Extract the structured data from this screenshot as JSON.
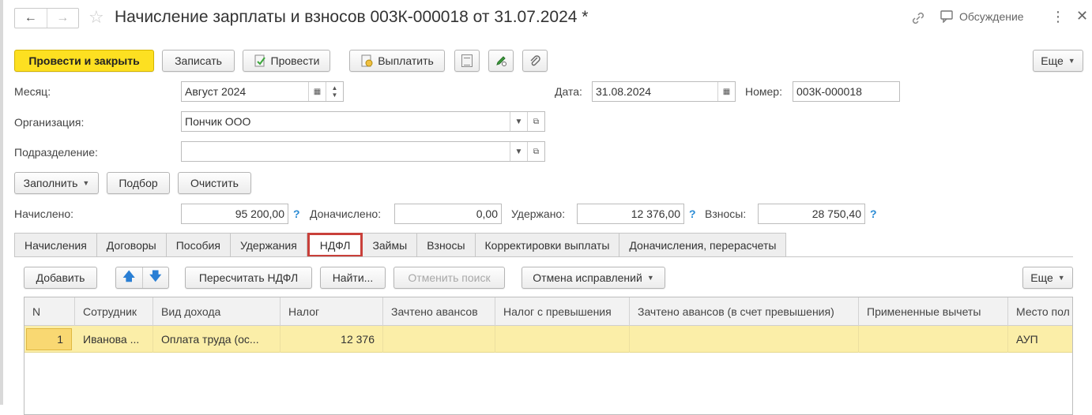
{
  "header": {
    "title": "Начисление зарплаты и взносов 003К-000018 от 31.07.2024 *",
    "discussion_label": "Обсуждение",
    "back_icon": "←",
    "forward_icon": "→"
  },
  "toolbar": {
    "post_and_close": "Провести и закрыть",
    "save": "Записать",
    "post": "Провести",
    "pay": "Выплатить",
    "more": "Еще"
  },
  "form": {
    "month_label": "Месяц:",
    "month_value": "Август 2024",
    "date_label": "Дата:",
    "date_value": "31.08.2024",
    "number_label": "Номер:",
    "number_value": "003К-000018",
    "org_label": "Организация:",
    "org_value": "Пончик ООО",
    "dept_label": "Подразделение:",
    "dept_value": ""
  },
  "actions": {
    "fill": "Заполнить",
    "pick": "Подбор",
    "clear": "Очистить"
  },
  "totals": {
    "accrued_label": "Начислено:",
    "accrued_value": "95 200,00",
    "extra_label": "Доначислено:",
    "extra_value": "0,00",
    "withheld_label": "Удержано:",
    "withheld_value": "12 376,00",
    "contrib_label": "Взносы:",
    "contrib_value": "28 750,40",
    "help": "?"
  },
  "tabs": [
    {
      "label": "Начисления"
    },
    {
      "label": "Договоры"
    },
    {
      "label": "Пособия"
    },
    {
      "label": "Удержания"
    },
    {
      "label": "НДФЛ"
    },
    {
      "label": "Займы"
    },
    {
      "label": "Взносы"
    },
    {
      "label": "Корректировки выплаты"
    },
    {
      "label": "Доначисления, перерасчеты"
    }
  ],
  "tab_toolbar": {
    "add": "Добавить",
    "recalc": "Пересчитать НДФЛ",
    "find": "Найти...",
    "cancel_search": "Отменить поиск",
    "cancel_fixes": "Отмена исправлений",
    "more": "Еще"
  },
  "table": {
    "columns": [
      "N",
      "Сотрудник",
      "Вид дохода",
      "Налог",
      "Зачтено авансов",
      "Налог с превышения",
      "Зачтено авансов (в счет превышения)",
      "Примененные вычеты",
      "Место пол"
    ],
    "rows": [
      {
        "n": "1",
        "employee": "Иванова ...",
        "income": "Оплата труда (ос...",
        "tax": "12 376",
        "advances": "",
        "tax_excess": "",
        "advances_excess": "",
        "deductions": "",
        "place": "АУП"
      }
    ]
  }
}
